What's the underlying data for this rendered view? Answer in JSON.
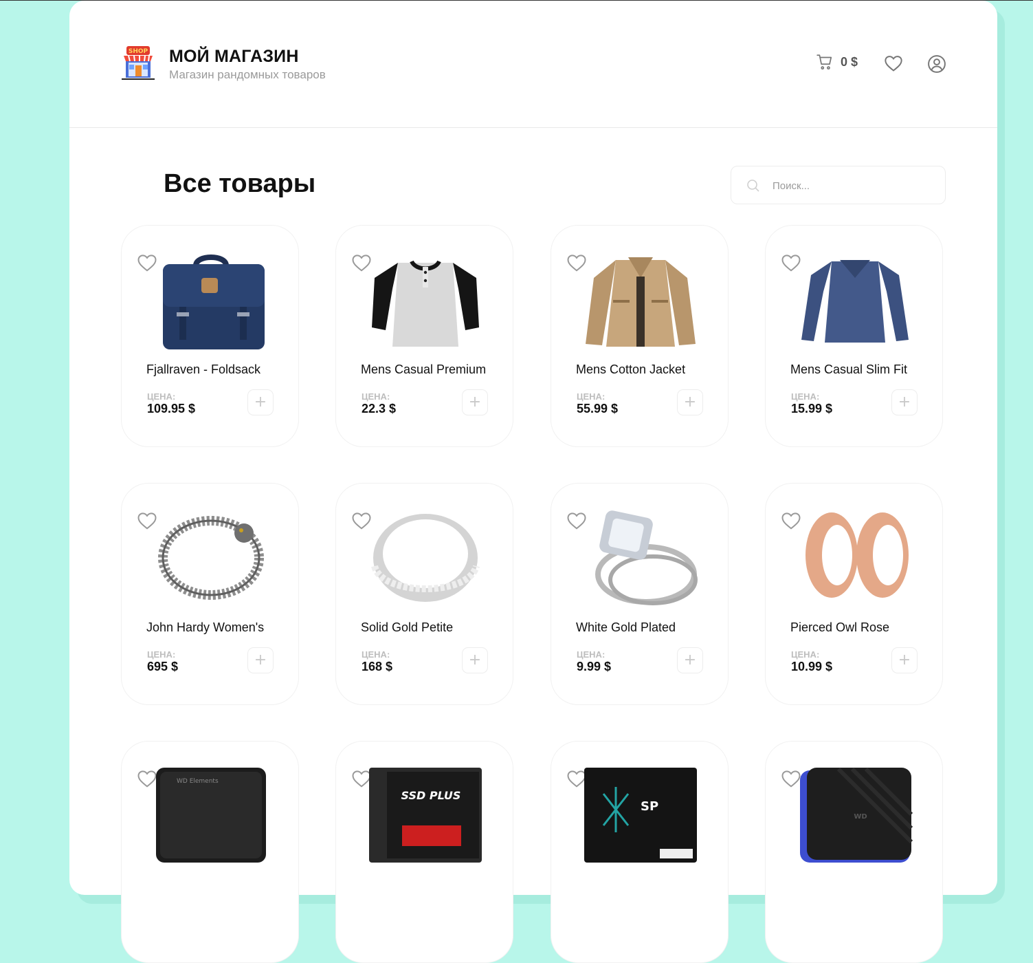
{
  "header": {
    "brand_title": "МОЙ МАГАЗИН",
    "brand_subtitle": "Магазин рандомных товаров",
    "logo_text": "SHOP",
    "cart_total": "0 $",
    "icons": [
      "cart-icon",
      "heart-icon",
      "user-icon"
    ]
  },
  "main": {
    "title": "Все товары",
    "search_placeholder": "Поиск..."
  },
  "labels": {
    "price": "ЦЕНА:",
    "add": "+"
  },
  "products": [
    {
      "name": "Fjallraven - Foldsack",
      "price": "109.95 $",
      "image": "backpack"
    },
    {
      "name": "Mens Casual Premium",
      "price": "22.3 $",
      "image": "raglan-tshirt"
    },
    {
      "name": "Mens Cotton Jacket",
      "price": "55.99 $",
      "image": "cotton-jacket"
    },
    {
      "name": "Mens Casual Slim Fit",
      "price": "15.99 $",
      "image": "longsleeve"
    },
    {
      "name": "John Hardy Women's",
      "price": "695 $",
      "image": "dragon-bracelet"
    },
    {
      "name": "Solid Gold Petite",
      "price": "168 $",
      "image": "silver-ring"
    },
    {
      "name": "White Gold Plated",
      "price": "9.99 $",
      "image": "diamond-ring"
    },
    {
      "name": "Pierced Owl Rose",
      "price": "10.99 $",
      "image": "rose-gold-tunnels"
    },
    {
      "name": "",
      "price": "",
      "image": "wd-external-drive",
      "image_text": "WD Elements"
    },
    {
      "name": "",
      "price": "",
      "image": "sandisk-ssd",
      "image_text": "SSD PLUS"
    },
    {
      "name": "",
      "price": "",
      "image": "silicon-power-ssd",
      "image_text": "SP"
    },
    {
      "name": "",
      "price": "",
      "image": "wd-gaming-drive",
      "image_text": "WD"
    }
  ],
  "colors": {
    "background": "#b8f6ea",
    "panel": "#ffffff",
    "text": "#111111",
    "muted": "#9a9a9a"
  }
}
